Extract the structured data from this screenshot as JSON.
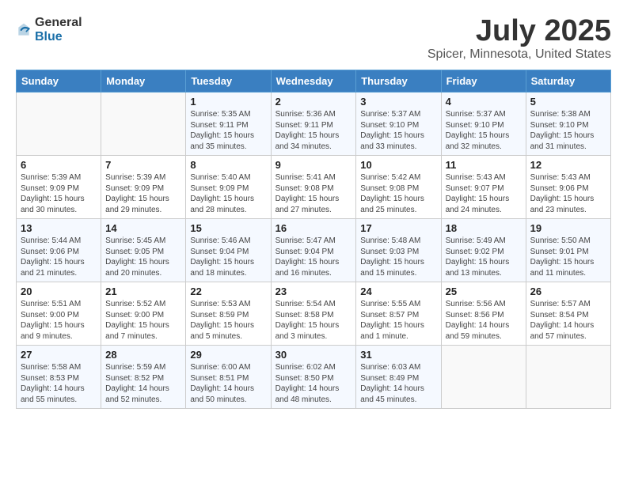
{
  "logo": {
    "general": "General",
    "blue": "Blue"
  },
  "header": {
    "month": "July 2025",
    "location": "Spicer, Minnesota, United States"
  },
  "weekdays": [
    "Sunday",
    "Monday",
    "Tuesday",
    "Wednesday",
    "Thursday",
    "Friday",
    "Saturday"
  ],
  "weeks": [
    [
      {
        "day": "",
        "info": ""
      },
      {
        "day": "",
        "info": ""
      },
      {
        "day": "1",
        "info": "Sunrise: 5:35 AM\nSunset: 9:11 PM\nDaylight: 15 hours\nand 35 minutes."
      },
      {
        "day": "2",
        "info": "Sunrise: 5:36 AM\nSunset: 9:11 PM\nDaylight: 15 hours\nand 34 minutes."
      },
      {
        "day": "3",
        "info": "Sunrise: 5:37 AM\nSunset: 9:10 PM\nDaylight: 15 hours\nand 33 minutes."
      },
      {
        "day": "4",
        "info": "Sunrise: 5:37 AM\nSunset: 9:10 PM\nDaylight: 15 hours\nand 32 minutes."
      },
      {
        "day": "5",
        "info": "Sunrise: 5:38 AM\nSunset: 9:10 PM\nDaylight: 15 hours\nand 31 minutes."
      }
    ],
    [
      {
        "day": "6",
        "info": "Sunrise: 5:39 AM\nSunset: 9:09 PM\nDaylight: 15 hours\nand 30 minutes."
      },
      {
        "day": "7",
        "info": "Sunrise: 5:39 AM\nSunset: 9:09 PM\nDaylight: 15 hours\nand 29 minutes."
      },
      {
        "day": "8",
        "info": "Sunrise: 5:40 AM\nSunset: 9:09 PM\nDaylight: 15 hours\nand 28 minutes."
      },
      {
        "day": "9",
        "info": "Sunrise: 5:41 AM\nSunset: 9:08 PM\nDaylight: 15 hours\nand 27 minutes."
      },
      {
        "day": "10",
        "info": "Sunrise: 5:42 AM\nSunset: 9:08 PM\nDaylight: 15 hours\nand 25 minutes."
      },
      {
        "day": "11",
        "info": "Sunrise: 5:43 AM\nSunset: 9:07 PM\nDaylight: 15 hours\nand 24 minutes."
      },
      {
        "day": "12",
        "info": "Sunrise: 5:43 AM\nSunset: 9:06 PM\nDaylight: 15 hours\nand 23 minutes."
      }
    ],
    [
      {
        "day": "13",
        "info": "Sunrise: 5:44 AM\nSunset: 9:06 PM\nDaylight: 15 hours\nand 21 minutes."
      },
      {
        "day": "14",
        "info": "Sunrise: 5:45 AM\nSunset: 9:05 PM\nDaylight: 15 hours\nand 20 minutes."
      },
      {
        "day": "15",
        "info": "Sunrise: 5:46 AM\nSunset: 9:04 PM\nDaylight: 15 hours\nand 18 minutes."
      },
      {
        "day": "16",
        "info": "Sunrise: 5:47 AM\nSunset: 9:04 PM\nDaylight: 15 hours\nand 16 minutes."
      },
      {
        "day": "17",
        "info": "Sunrise: 5:48 AM\nSunset: 9:03 PM\nDaylight: 15 hours\nand 15 minutes."
      },
      {
        "day": "18",
        "info": "Sunrise: 5:49 AM\nSunset: 9:02 PM\nDaylight: 15 hours\nand 13 minutes."
      },
      {
        "day": "19",
        "info": "Sunrise: 5:50 AM\nSunset: 9:01 PM\nDaylight: 15 hours\nand 11 minutes."
      }
    ],
    [
      {
        "day": "20",
        "info": "Sunrise: 5:51 AM\nSunset: 9:00 PM\nDaylight: 15 hours\nand 9 minutes."
      },
      {
        "day": "21",
        "info": "Sunrise: 5:52 AM\nSunset: 9:00 PM\nDaylight: 15 hours\nand 7 minutes."
      },
      {
        "day": "22",
        "info": "Sunrise: 5:53 AM\nSunset: 8:59 PM\nDaylight: 15 hours\nand 5 minutes."
      },
      {
        "day": "23",
        "info": "Sunrise: 5:54 AM\nSunset: 8:58 PM\nDaylight: 15 hours\nand 3 minutes."
      },
      {
        "day": "24",
        "info": "Sunrise: 5:55 AM\nSunset: 8:57 PM\nDaylight: 15 hours\nand 1 minute."
      },
      {
        "day": "25",
        "info": "Sunrise: 5:56 AM\nSunset: 8:56 PM\nDaylight: 14 hours\nand 59 minutes."
      },
      {
        "day": "26",
        "info": "Sunrise: 5:57 AM\nSunset: 8:54 PM\nDaylight: 14 hours\nand 57 minutes."
      }
    ],
    [
      {
        "day": "27",
        "info": "Sunrise: 5:58 AM\nSunset: 8:53 PM\nDaylight: 14 hours\nand 55 minutes."
      },
      {
        "day": "28",
        "info": "Sunrise: 5:59 AM\nSunset: 8:52 PM\nDaylight: 14 hours\nand 52 minutes."
      },
      {
        "day": "29",
        "info": "Sunrise: 6:00 AM\nSunset: 8:51 PM\nDaylight: 14 hours\nand 50 minutes."
      },
      {
        "day": "30",
        "info": "Sunrise: 6:02 AM\nSunset: 8:50 PM\nDaylight: 14 hours\nand 48 minutes."
      },
      {
        "day": "31",
        "info": "Sunrise: 6:03 AM\nSunset: 8:49 PM\nDaylight: 14 hours\nand 45 minutes."
      },
      {
        "day": "",
        "info": ""
      },
      {
        "day": "",
        "info": ""
      }
    ]
  ]
}
